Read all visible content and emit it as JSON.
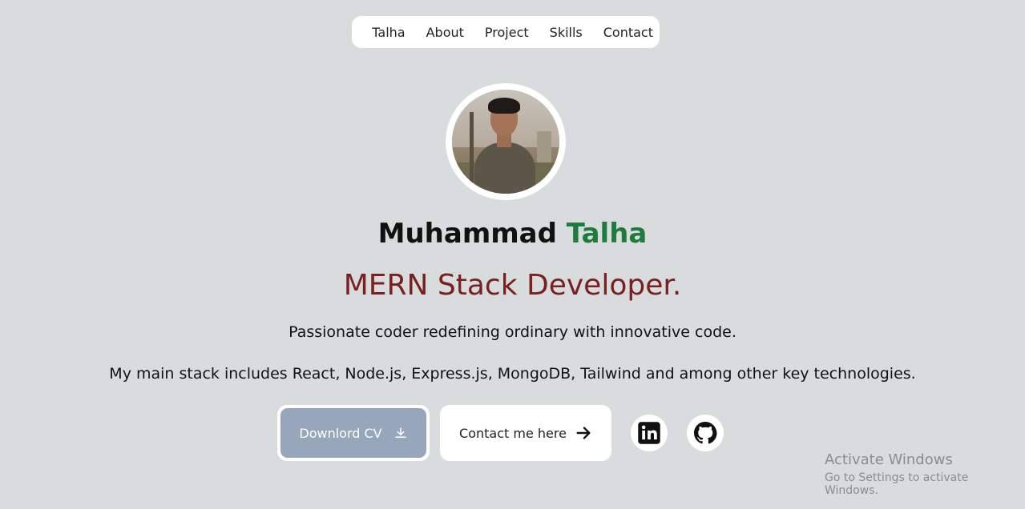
{
  "nav": {
    "items": [
      {
        "label": "Talha"
      },
      {
        "label": "About"
      },
      {
        "label": "Project"
      },
      {
        "label": "Skills"
      },
      {
        "label": "Contact"
      }
    ]
  },
  "hero": {
    "name_first": "Muhammad",
    "name_last": "Talha",
    "role": "MERN Stack Developer.",
    "tagline": "Passionate coder redefining ordinary with innovative code.",
    "stack": "My main stack includes React, Node.js, Express.js, MongoDB, Tailwind and among other key technologies."
  },
  "actions": {
    "cv_label": "Downlord CV",
    "contact_label": "Contact me here"
  },
  "icons": {
    "download": "download-icon",
    "arrow": "arrow-right-icon",
    "linkedin": "linkedin-icon",
    "github": "github-icon"
  },
  "colors": {
    "background": "#d8dcdd",
    "accent_green": "#1f7a3e",
    "role_red": "#7a2020",
    "cv_button": "#97a6bb"
  },
  "watermark": {
    "title": "Activate Windows",
    "subtitle": "Go to Settings to activate Windows."
  }
}
